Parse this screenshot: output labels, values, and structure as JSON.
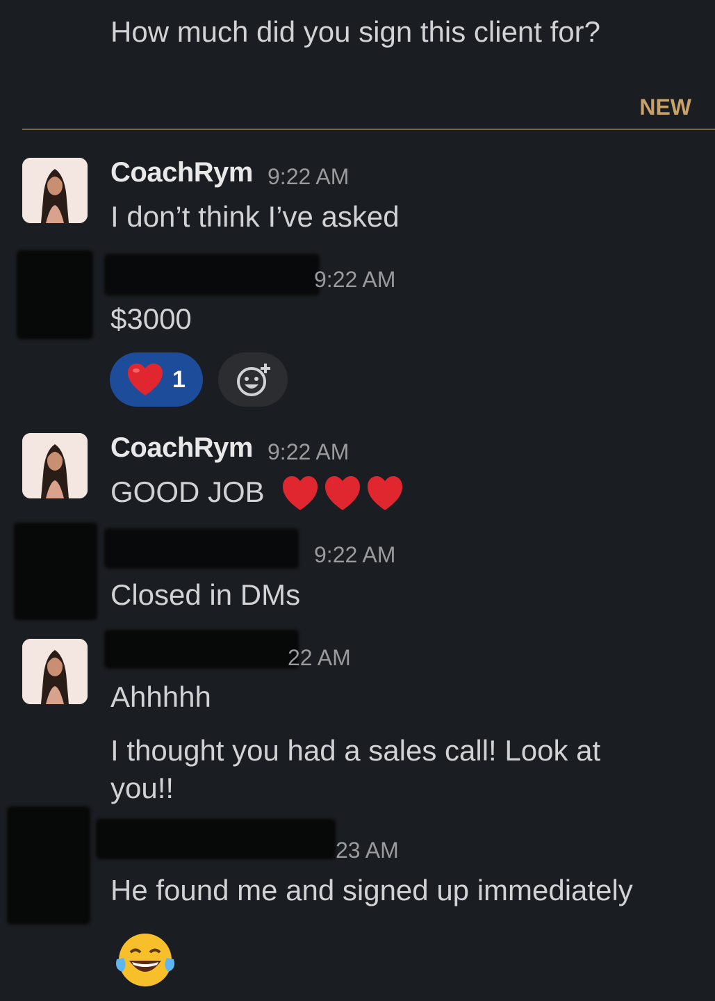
{
  "top_message": {
    "text": "How much did you sign this client for?"
  },
  "divider": {
    "label": "NEW",
    "color": "#c8a26a"
  },
  "messages": [
    {
      "author": "CoachRym",
      "time": "9:22 AM",
      "text": "I don’t think I’ve asked"
    },
    {
      "author": "",
      "time": "9:22 AM",
      "text": "$3000"
    },
    {
      "author": "CoachRym",
      "time": "9:22 AM",
      "text": "GOOD JOB"
    },
    {
      "author": "",
      "time": "9:22 AM",
      "text": "Closed in DMs"
    },
    {
      "author": "",
      "time": "22 AM",
      "text": "Ahhhhh",
      "text2": "I thought you had a sales call! Look at",
      "text3": "you!!"
    },
    {
      "author": "",
      "time": "23 AM",
      "text": "He found me and signed up immediately"
    }
  ],
  "reactions": {
    "heart_count": "1",
    "heart_icon": "heart-emoji",
    "add_icon": "add-reaction-icon"
  },
  "colors": {
    "background": "#1a1d21",
    "reaction_active": "#1d4c9b",
    "reaction_inactive": "#2b2d31"
  }
}
